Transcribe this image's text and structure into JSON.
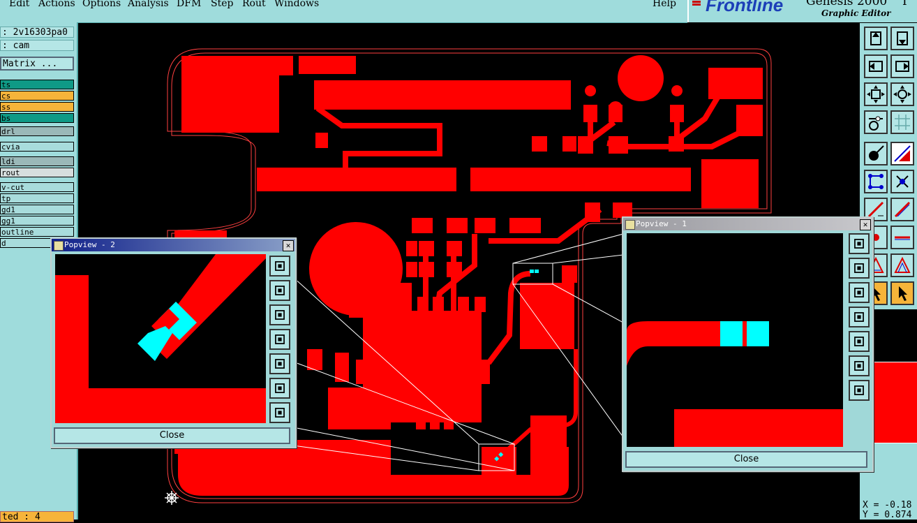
{
  "menu": {
    "items": [
      "Edit",
      "Actions",
      "Options",
      "Analysis",
      "DFM",
      "Step",
      "Rout",
      "Windows"
    ],
    "help": "Help"
  },
  "logo": {
    "brand": "Frontline",
    "product": "Genesis 2000",
    "subtitle": "Graphic Editor",
    "version_tail": "I"
  },
  "job": {
    "job_field": ": 2v16303pa0",
    "step_field": ": cam",
    "matrix_button": "Matrix ..."
  },
  "layers": [
    {
      "label": "ts",
      "bg": "#0f9a86"
    },
    {
      "label": "cs",
      "bg": "#f6b43a"
    },
    {
      "label": "ss",
      "bg": "#f6b43a"
    },
    {
      "label": "bs",
      "bg": "#0f9a86"
    },
    {
      "label": "drl",
      "bg": "#9ab8b8"
    },
    {
      "label": "cvia",
      "bg": "#a8dcdc"
    },
    {
      "label": "ldi",
      "bg": "#9ab8b8"
    },
    {
      "label": "rout",
      "bg": "#d6dede"
    },
    {
      "label": "v-cut",
      "bg": "#a8dcdc"
    },
    {
      "label": "tp",
      "bg": "#a8dcdc"
    },
    {
      "label": "gd1",
      "bg": "#a8dcdc"
    },
    {
      "label": "gg1",
      "bg": "#a8dcdc"
    },
    {
      "label": "outline",
      "bg": "#a8dcdc"
    },
    {
      "label": "d",
      "bg": "#a8dcdc"
    }
  ],
  "status": {
    "selected": "ted : 4"
  },
  "coords": {
    "x": "X = -0.18",
    "y": "Y = 0.874"
  },
  "popview1": {
    "title": "Popview - 1",
    "close": "Close",
    "close_x": "✕"
  },
  "popview2": {
    "title": "Popview - 2",
    "close": "Close",
    "close_x": "✕"
  },
  "colors": {
    "copper": "#ff0000",
    "highlight": "#00ffff",
    "panel": "#9fdcdc"
  }
}
